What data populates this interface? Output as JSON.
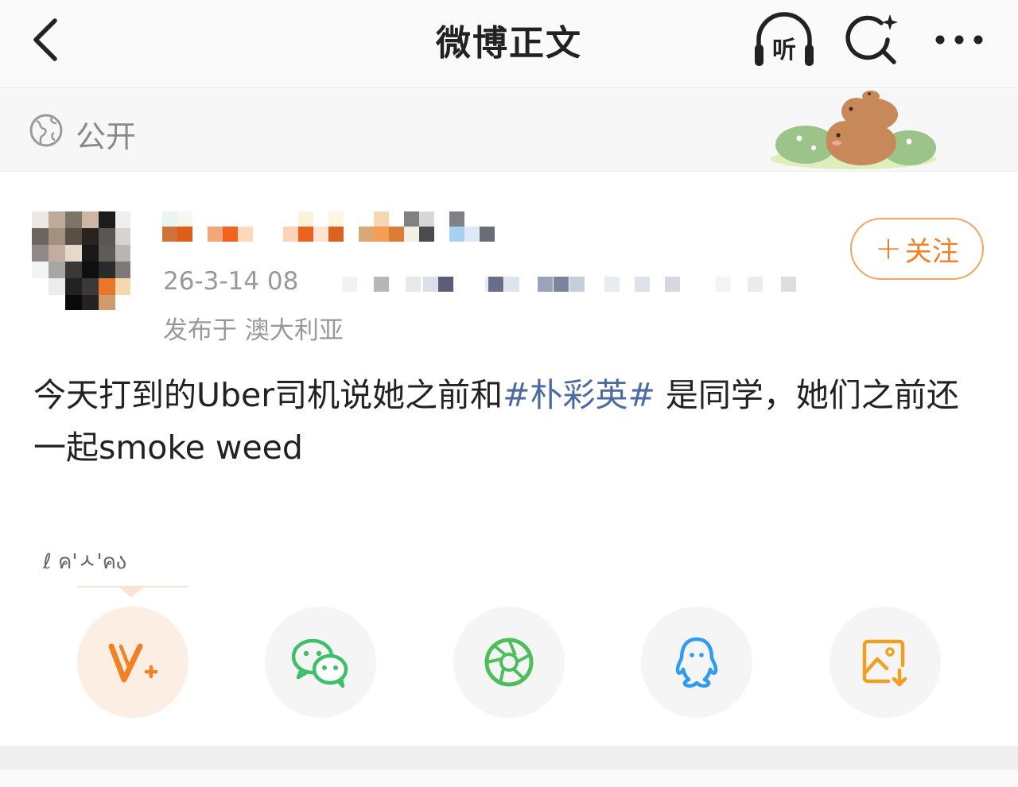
{
  "navbar": {
    "title": "微博正文",
    "listen_label": "听"
  },
  "visibility": {
    "label": "公开"
  },
  "post": {
    "time_prefix": "26-3-14 08",
    "location": "发布于 澳大利亚",
    "follow_label": "关注",
    "text_part1": "今天打到的Uber司机说她之前和",
    "hashtag": "#朴彩英#",
    "text_part2": " 是同学，她们之前还一起smoke weed"
  },
  "kaomoji": "ℓ ค'ㅅ'คა",
  "colors": {
    "accent_orange": "#f08124",
    "hashtag_blue": "#4c6b9e",
    "wechat_green": "#3fbf6a",
    "qq_blue": "#2e9cf0"
  },
  "share_icons": [
    "weibo-v-plus-icon",
    "wechat-icon",
    "moments-icon",
    "qq-icon",
    "save-image-icon"
  ]
}
